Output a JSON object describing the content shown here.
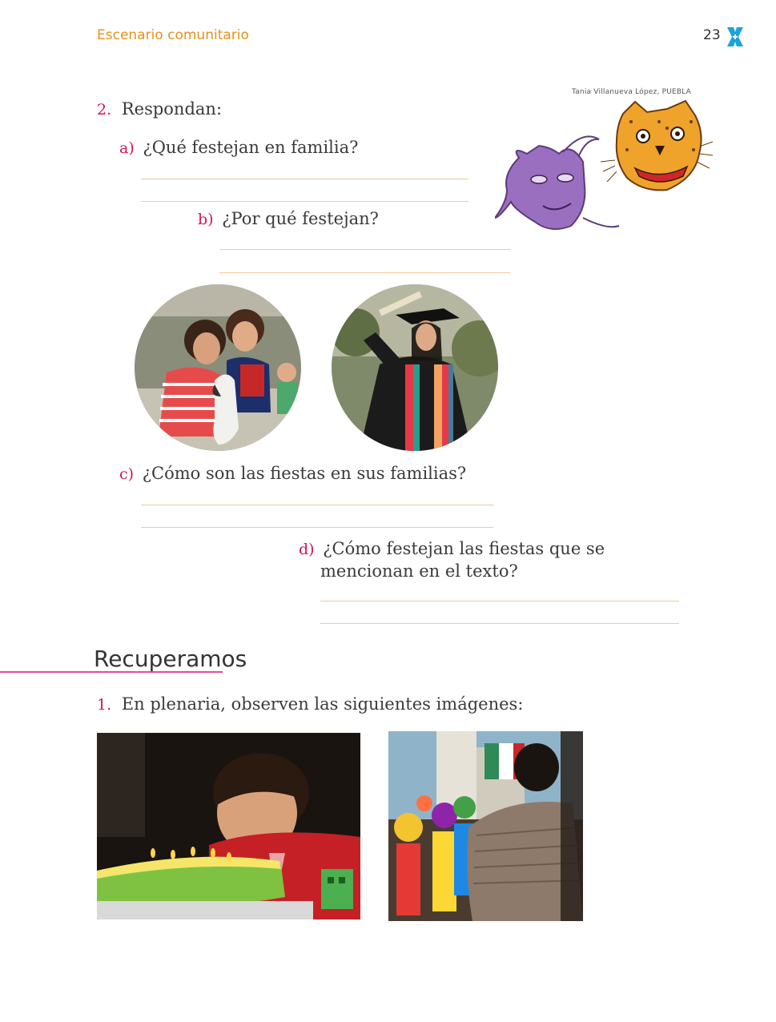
{
  "header": {
    "title": "Escenario comunitario",
    "page_number": "23"
  },
  "illustration": {
    "credit": "Tania Villanueva López, PUEBLA"
  },
  "question2": {
    "number": "2.",
    "label": "Respondan:",
    "items": [
      {
        "letter": "a)",
        "text": "¿Qué festejan en familia?"
      },
      {
        "letter": "b)",
        "text": "¿Por qué festejan?"
      },
      {
        "letter": "c)",
        "text": "¿Cómo son las fiestas en sus familias?"
      },
      {
        "letter": "d)",
        "text": "¿Cómo festejan las fiestas que se",
        "text2": "mencionan en el texto?"
      }
    ]
  },
  "section": {
    "title": "Recuperamos"
  },
  "question1": {
    "number": "1.",
    "label": "En plenaria, observen las siguientes imágenes:"
  },
  "colors": {
    "accent_orange": "#e8901c",
    "accent_magenta": "#d4145a",
    "answer_line": "#f2c89a",
    "logo_blue": "#1aa3dc"
  }
}
